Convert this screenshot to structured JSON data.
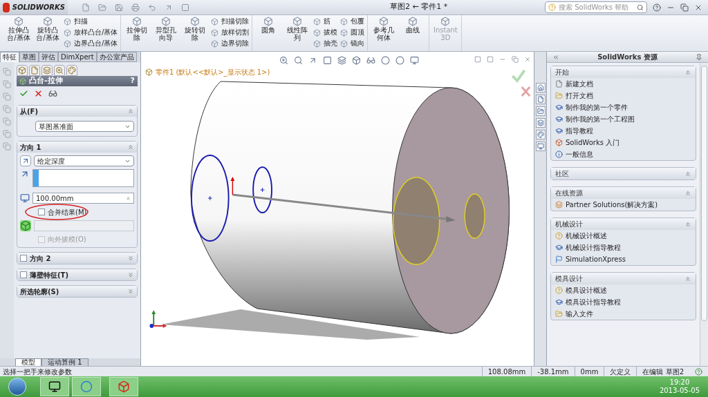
{
  "title_bar": {
    "app_name": "SOLIDWORKS",
    "document_title": "草图2 ← 零件1 *",
    "search": {
      "placeholder": "搜索 SolidWorks 帮助"
    }
  },
  "ribbon": {
    "groups": [
      {
        "items": [
          {
            "kind": "large",
            "label": "拉伸凸台/基体",
            "disabled": false
          },
          {
            "kind": "large",
            "label": "旋转凸台/基体",
            "disabled": false
          },
          {
            "kind": "stack",
            "entries": [
              "扫描",
              "放样凸台/基体",
              "边界凸台/基体"
            ]
          }
        ]
      },
      {
        "items": [
          {
            "kind": "large",
            "label": "拉伸切除",
            "disabled": false
          },
          {
            "kind": "large",
            "label": "异型孔向导",
            "disabled": false
          },
          {
            "kind": "large",
            "label": "旋转切除",
            "disabled": false
          },
          {
            "kind": "stack",
            "entries": [
              "扫描切除",
              "放样切割",
              "边界切除"
            ]
          }
        ]
      },
      {
        "items": [
          {
            "kind": "large",
            "label": "圆角",
            "disabled": false
          },
          {
            "kind": "large",
            "label": "线性阵列",
            "disabled": false
          },
          {
            "kind": "stack",
            "entries": [
              "筋",
              "拔模",
              "抽壳"
            ]
          },
          {
            "kind": "stack",
            "entries": [
              "包覆",
              "圆顶",
              "镜向"
            ]
          }
        ]
      },
      {
        "items": [
          {
            "kind": "large",
            "label": "参考几何体",
            "disabled": false
          },
          {
            "kind": "large",
            "label": "曲线",
            "disabled": false
          }
        ]
      },
      {
        "items": [
          {
            "kind": "large",
            "label": "Instant3D",
            "disabled": true
          }
        ]
      }
    ]
  },
  "tabs": [
    {
      "label": "特征",
      "selected": true
    },
    {
      "label": "草图",
      "selected": false
    },
    {
      "label": "评估",
      "selected": false
    },
    {
      "label": "DimXpert",
      "selected": false
    },
    {
      "label": "办公室产品",
      "selected": false
    }
  ],
  "property_manager": {
    "title": "凸台-拉伸",
    "help": "?",
    "sections": [
      {
        "kind": "from",
        "title": "从(F)",
        "expanded": true,
        "start": "草图基准面"
      },
      {
        "kind": "direction",
        "title": "方向 1",
        "expanded": true,
        "end_condition": "给定深度",
        "depth": "100.00mm",
        "merge": {
          "label": "合并结果(M)",
          "checked": false,
          "circled": true
        },
        "draft": {
          "label": "向外拔模(O)",
          "checked": false,
          "disabled": true
        }
      },
      {
        "kind": "plain",
        "title": "方向 2",
        "expanded": false,
        "checked": false
      },
      {
        "kind": "plain",
        "title": "薄壁特征(T)",
        "expanded": false,
        "checked": false
      },
      {
        "kind": "plain",
        "title": "所选轮廓(S)",
        "expanded": false
      }
    ]
  },
  "viewport": {
    "tree_label": "零件1  (默认<<默认>_显示状态 1>)"
  },
  "bottom_tabs": [
    {
      "label": "模型",
      "selected": true
    },
    {
      "label": "运动算例 1",
      "selected": false
    }
  ],
  "task_pane": {
    "title": "SolidWorks 资源",
    "sections": [
      {
        "title": "开始",
        "expanded": true,
        "items": [
          {
            "kind": "document",
            "label": "新建文档"
          },
          {
            "kind": "folder",
            "label": "打开文档"
          },
          {
            "kind": "tutorial",
            "label": "制作我的第一个零件"
          },
          {
            "kind": "tutorial",
            "label": "制作我的第一个工程图"
          },
          {
            "kind": "tutorial",
            "label": "指导教程"
          },
          {
            "kind": "intro",
            "label": "SolidWorks 入门"
          },
          {
            "kind": "info",
            "label": "一般信息"
          }
        ]
      },
      {
        "title": "社区",
        "expanded": true
      },
      {
        "title": "在线资源",
        "expanded": true,
        "items": [
          {
            "kind": "partner",
            "label": "Partner Solutions(解决方案)"
          }
        ]
      },
      {
        "title": "机械设计",
        "expanded": true,
        "items": [
          {
            "kind": "help",
            "label": "机械设计概述"
          },
          {
            "kind": "tutorial",
            "label": "机械设计指导教程"
          },
          {
            "kind": "simulation",
            "label": "SimulationXpress"
          }
        ]
      },
      {
        "title": "模具设计",
        "expanded": true,
        "items": [
          {
            "kind": "help",
            "label": "模具设计概述"
          },
          {
            "kind": "tutorial",
            "label": "模具设计指导教程"
          },
          {
            "kind": "folder",
            "label": "输入文件"
          }
        ]
      }
    ]
  },
  "status_bar": {
    "message": "选择一把手来修改参数",
    "fields": [
      "108.08mm",
      "-38.1mm",
      "0mm",
      "欠定义",
      "在编辑 草图2"
    ]
  },
  "taskbar": {
    "time": "19:20",
    "date": "2013-05-05"
  }
}
